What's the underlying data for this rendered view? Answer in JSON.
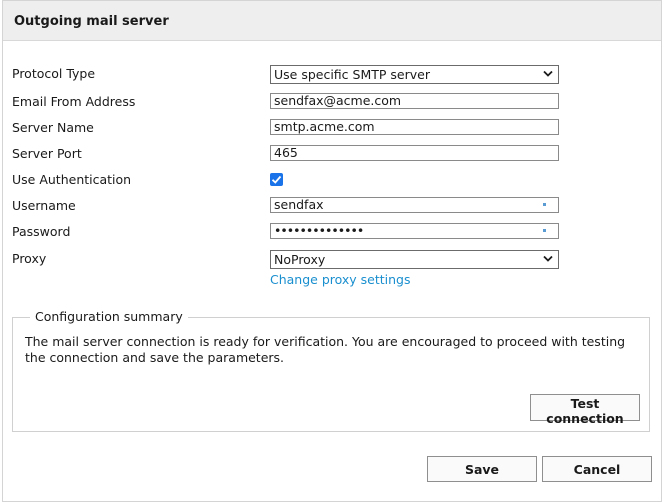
{
  "header": {
    "title": "Outgoing mail server"
  },
  "form": {
    "protocol": {
      "label": "Protocol Type",
      "value": "Use specific SMTP server"
    },
    "from": {
      "label": "Email From Address",
      "value": "sendfax@acme.com"
    },
    "server": {
      "label": "Server Name",
      "value": "smtp.acme.com"
    },
    "port": {
      "label": "Server Port",
      "value": "465"
    },
    "auth": {
      "label": "Use Authentication",
      "checked": true
    },
    "username": {
      "label": "Username",
      "value": "sendfax"
    },
    "password": {
      "label": "Password",
      "value": "••••••••••••••"
    },
    "proxy": {
      "label": "Proxy",
      "value": "NoProxy"
    },
    "proxy_link": "Change proxy settings"
  },
  "summary": {
    "legend": "Configuration summary",
    "text": "The mail server connection is ready for verification. You are encouraged to proceed with testing the connection and save the parameters.",
    "test_button": "Test connection"
  },
  "footer": {
    "save_label": "Save",
    "cancel_label": "Cancel"
  },
  "colors": {
    "accent": "#1a73e8",
    "link": "#1a8fcf",
    "header_bg": "#eeeeee"
  }
}
